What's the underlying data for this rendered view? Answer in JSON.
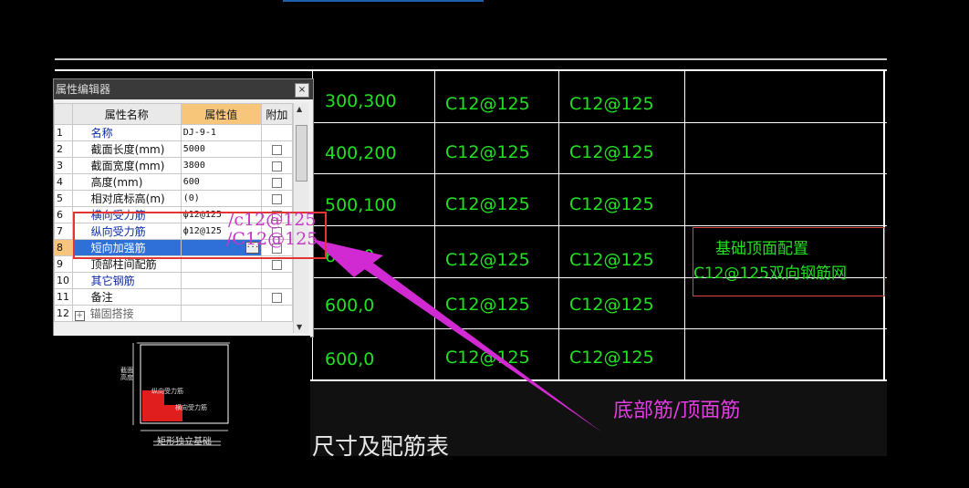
{
  "panel": {
    "title": "属性编辑器",
    "close": "×",
    "headers": {
      "name": "属性名称",
      "value": "属性值",
      "extra": "附加"
    },
    "rows": [
      {
        "num": "1",
        "name": "名称",
        "value": "DJ-9-1"
      },
      {
        "num": "2",
        "name": "截面长度(mm)",
        "value": "5000"
      },
      {
        "num": "3",
        "name": "截面宽度(mm)",
        "value": "3800"
      },
      {
        "num": "4",
        "name": "高度(mm)",
        "value": "600"
      },
      {
        "num": "5",
        "name": "相对底标高(m)",
        "value": "(0)"
      },
      {
        "num": "6",
        "name": "横向受力筋",
        "value": "ф12@125"
      },
      {
        "num": "7",
        "name": "纵向受力筋",
        "value": "ф12@125"
      },
      {
        "num": "8",
        "name": "短向加强筋",
        "value": ""
      },
      {
        "num": "9",
        "name": "顶部柱间配筋",
        "value": ""
      },
      {
        "num": "10",
        "name": "其它钢筋",
        "value": ""
      },
      {
        "num": "11",
        "name": "备注",
        "value": ""
      },
      {
        "num": "12",
        "name": "锚固搭接",
        "value": ""
      }
    ],
    "overlay1": "/c12@125",
    "overlay2": "/C12@125"
  },
  "preview": {
    "label_height": "截面高度",
    "label_long": "纵向受力筋",
    "label_cross": "横向受力筋",
    "title": "矩形独立基础"
  },
  "cad_table": {
    "rows": [
      [
        "300,300",
        "C12@125",
        "C12@125"
      ],
      [
        "400,200",
        "C12@125",
        "C12@125"
      ],
      [
        "500,100",
        "C12@125",
        "C12@125"
      ],
      [
        "600,0",
        "C12@125",
        "C12@125"
      ],
      [
        "600,0",
        "C12@125",
        "C12@125"
      ],
      [
        "600,0",
        "C12@125",
        "C12@125"
      ]
    ],
    "note_line1": "基础顶面配置",
    "note_line2": "C12@125双向钢筋网",
    "caption": "尺寸及配筋表"
  },
  "annotation": {
    "label": "底部筋/顶面筋"
  },
  "colors": {
    "cad_text": "#21e021",
    "annotation": "#e23de2",
    "highlight": "#e43535"
  }
}
